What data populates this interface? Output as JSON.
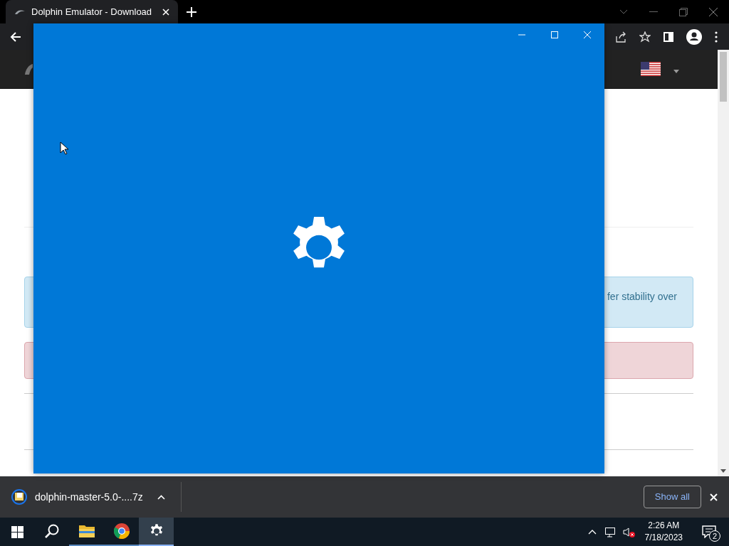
{
  "browser": {
    "tabs": [
      {
        "title": "Dolphin Emulator - Download",
        "selected": true
      }
    ]
  },
  "page": {
    "info_alert": "fer stability over"
  },
  "downloads": {
    "file": "dolphin-master-5.0-....7z",
    "show_all": "Show all"
  },
  "taskbar": {
    "apps": [
      {
        "kind": "search",
        "selected": false
      },
      {
        "kind": "explorer",
        "selected": false
      },
      {
        "kind": "chrome",
        "selected": false
      },
      {
        "kind": "settings",
        "selected": true
      }
    ],
    "time": "2:26 AM",
    "date": "7/18/2023",
    "notifications": "2"
  }
}
